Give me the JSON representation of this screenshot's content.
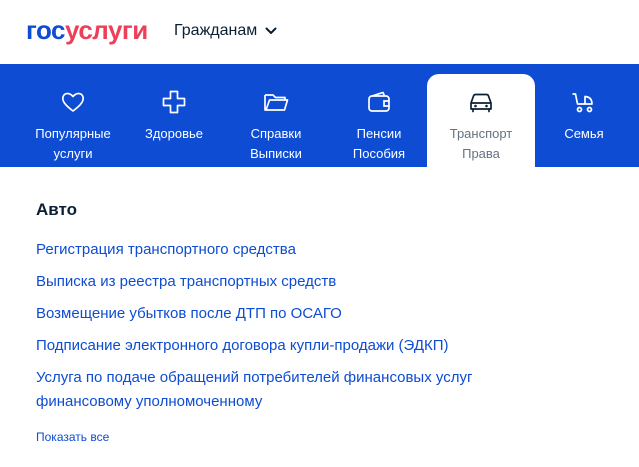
{
  "header": {
    "logo_part1": "гос",
    "logo_part2": "услуги",
    "audience_label": "Гражданам"
  },
  "categories": [
    {
      "icon": "heart-icon",
      "label": "Популярные\nуслуги",
      "active": false
    },
    {
      "icon": "health-cross-icon",
      "label": "Здоровье",
      "active": false
    },
    {
      "icon": "folder-icon",
      "label": "Справки\nВыписки",
      "active": false
    },
    {
      "icon": "wallet-icon",
      "label": "Пенсии\nПособия",
      "active": false
    },
    {
      "icon": "car-icon",
      "label": "Транспорт\nПрава",
      "active": true
    },
    {
      "icon": "stroller-icon",
      "label": "Семья",
      "active": false
    }
  ],
  "section": {
    "title": "Авто",
    "links": [
      "Регистрация транспортного средства",
      "Выписка из реестра транспортных средств",
      "Возмещение убытков после ДТП по ОСАГО",
      "Подписание электронного договора купли-продажи (ЭДКП)",
      "Услуга по подаче обращений потребителей финансовых услуг финансовому уполномоченному"
    ],
    "show_all": "Показать все"
  },
  "colors": {
    "brand_blue": "#0d4cd3",
    "brand_red": "#ee3f58",
    "inactive_tab_text": "#66727f"
  }
}
